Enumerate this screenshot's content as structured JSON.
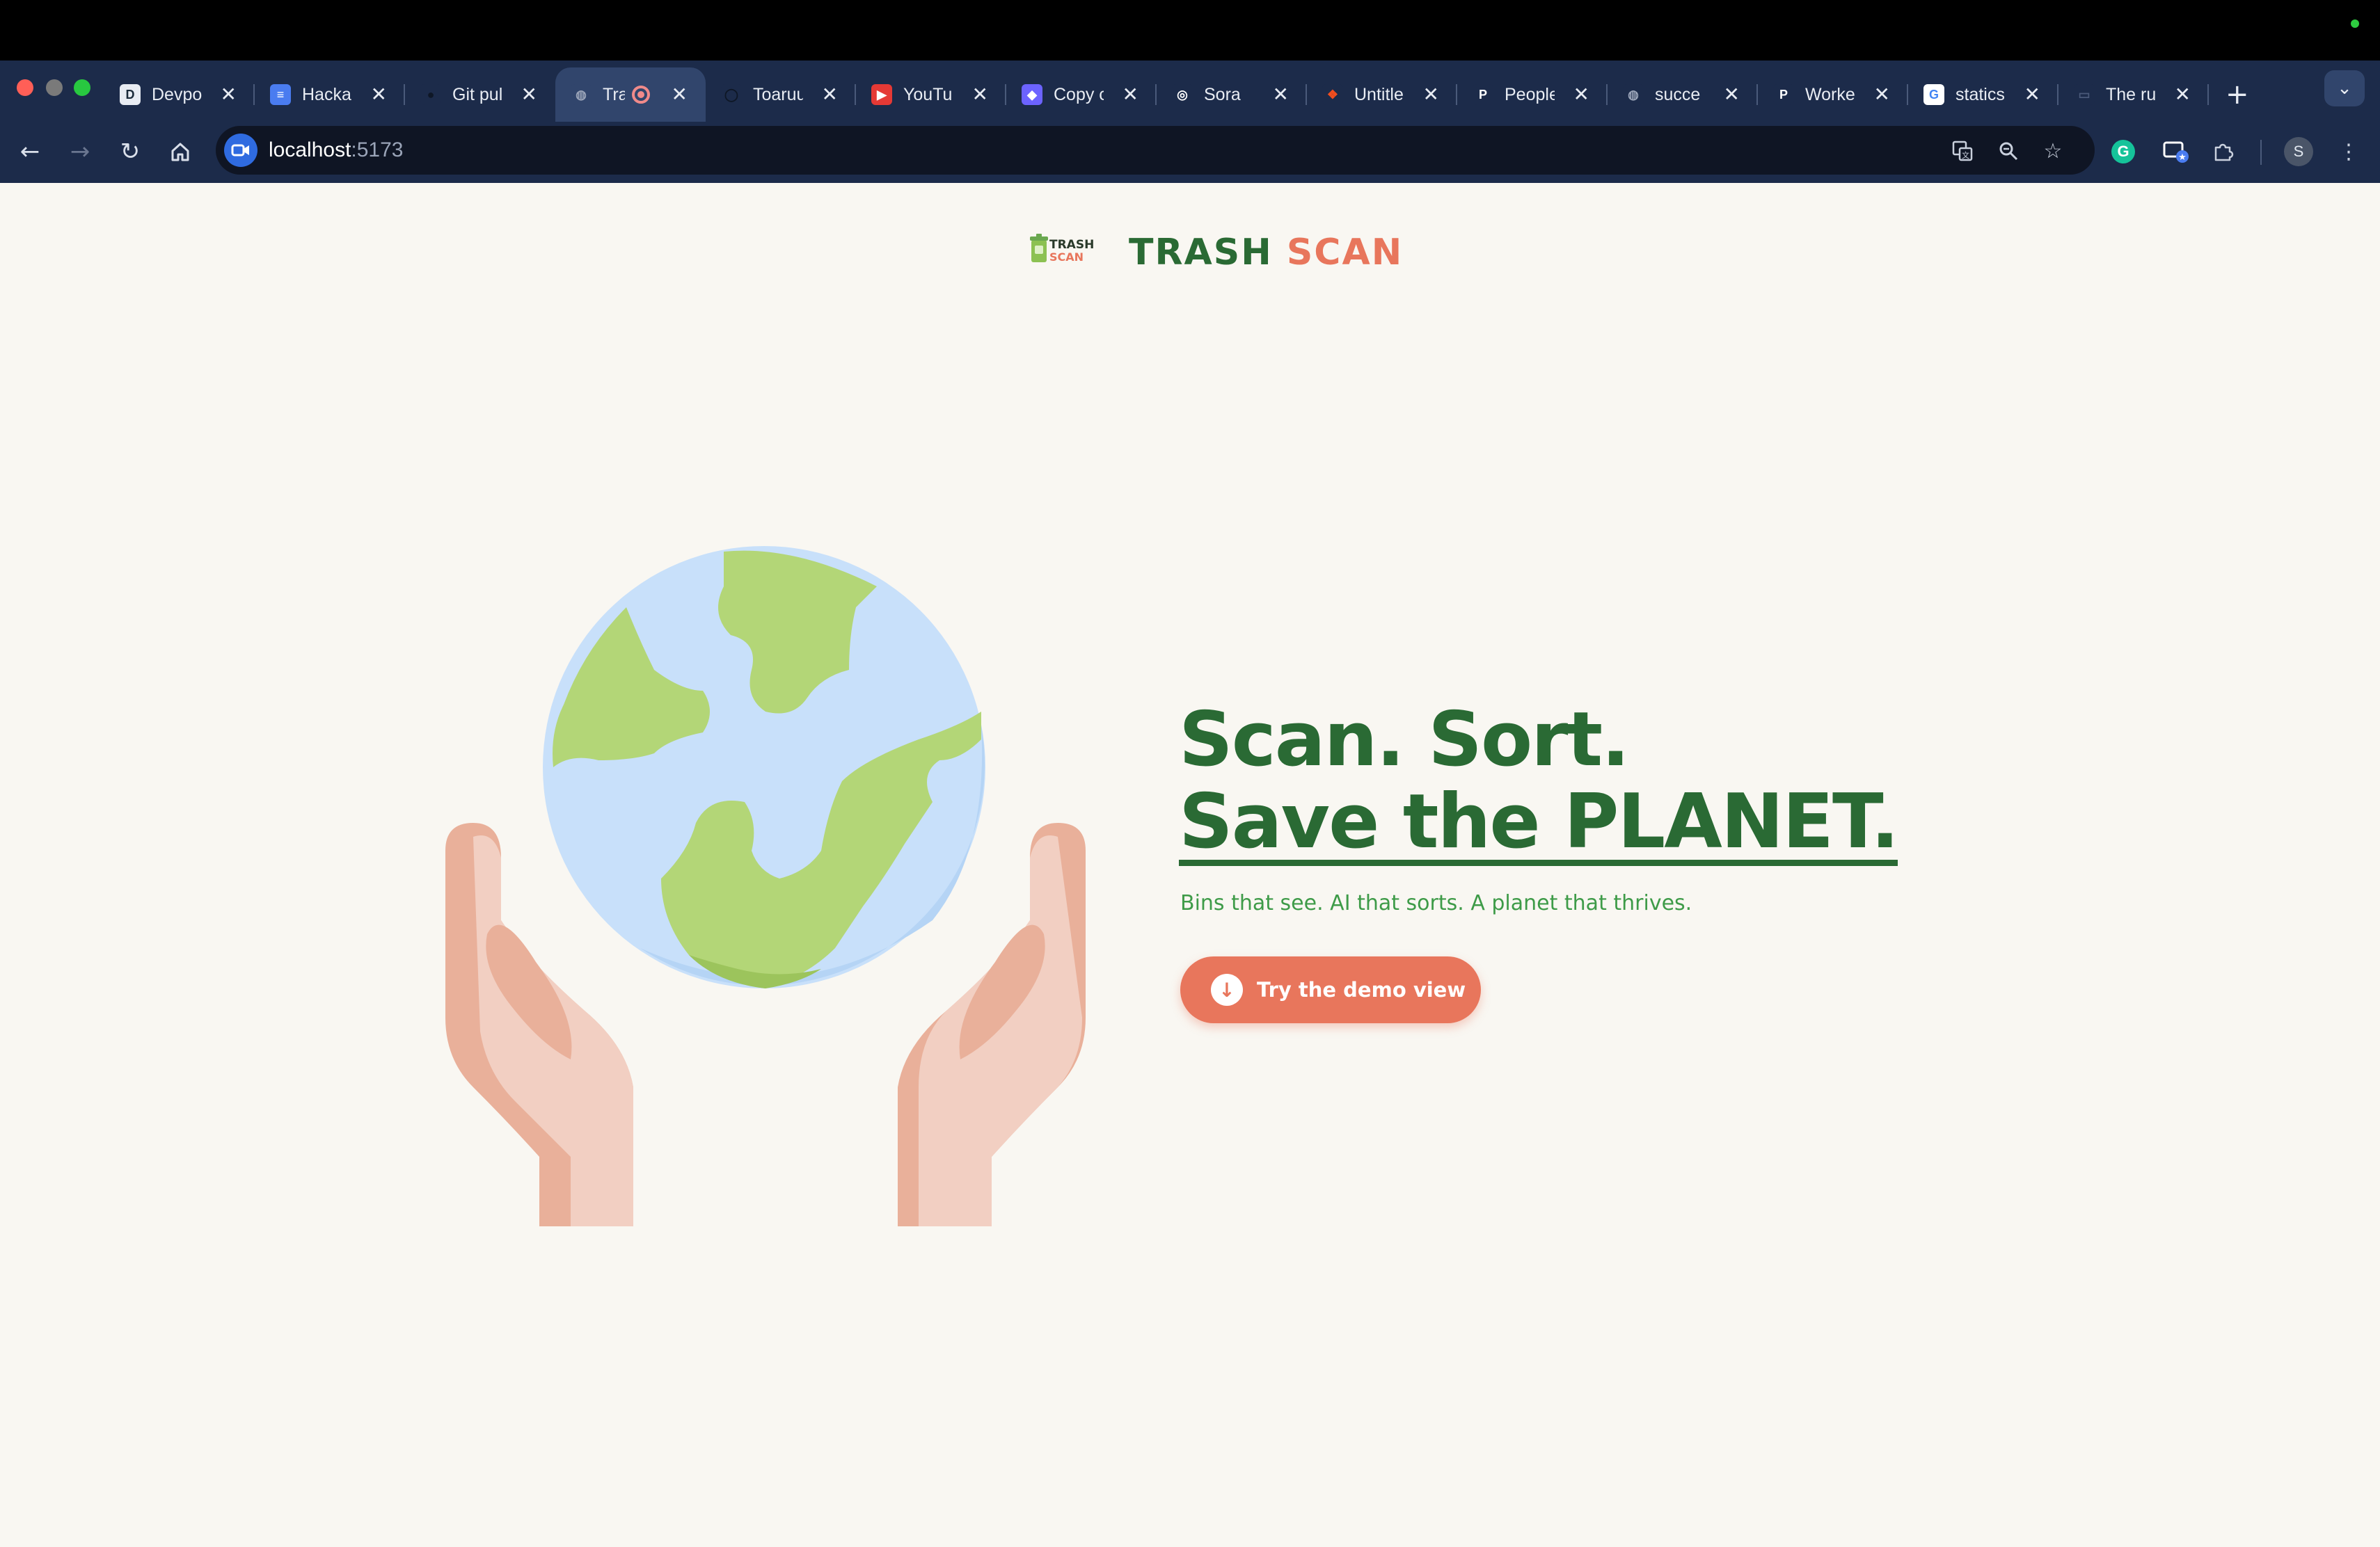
{
  "browser": {
    "tabs": [
      {
        "label": "Devpo",
        "favicon": "D",
        "favicon_color": "#1a2a3a",
        "favicon_bg": "#e8ecf3"
      },
      {
        "label": "Hacka",
        "favicon": "≡",
        "favicon_color": "#ffffff",
        "favicon_bg": "#4a7cf0"
      },
      {
        "label": "Git pul",
        "favicon": "●",
        "favicon_color": "#0e1726",
        "favicon_bg": "#1c2b4a"
      },
      {
        "label": "Tra",
        "favicon": "◍",
        "favicon_color": "#9aa4b8",
        "favicon_bg": "#31456c",
        "active": true,
        "recording": true
      },
      {
        "label": "Toaruu",
        "favicon": "◯",
        "favicon_color": "#0e1726",
        "favicon_bg": "#1c2b4a"
      },
      {
        "label": "YouTub",
        "favicon": "▶",
        "favicon_color": "#ffffff",
        "favicon_bg": "#e53935"
      },
      {
        "label": "Copy c",
        "favicon": "◆",
        "favicon_color": "#ffffff",
        "favicon_bg": "#6c63ff"
      },
      {
        "label": "Sora",
        "favicon": "◎",
        "favicon_color": "#ffffff",
        "favicon_bg": "#1c2b4a"
      },
      {
        "label": "Untitle",
        "favicon": "❖",
        "favicon_color": "#f24e1e",
        "favicon_bg": "#1c2b4a"
      },
      {
        "label": "People",
        "favicon": "P",
        "favicon_color": "#ffffff",
        "favicon_bg": "#1c2b4a"
      },
      {
        "label": "succe",
        "favicon": "◍",
        "favicon_color": "#9aa4b8",
        "favicon_bg": "#1c2b4a"
      },
      {
        "label": "Worke",
        "favicon": "P",
        "favicon_color": "#ffffff",
        "favicon_bg": "#1c2b4a"
      },
      {
        "label": "statics",
        "favicon": "G",
        "favicon_color": "#4285f4",
        "favicon_bg": "#ffffff"
      },
      {
        "label": "The ru",
        "favicon": "▭",
        "favicon_color": "#4a5a7a",
        "favicon_bg": "#1c2b4a"
      }
    ],
    "new_tab": "+",
    "tab_menu": "⌄",
    "url_host": "localhost",
    "url_port": ":5173",
    "profile_initial": "S"
  },
  "page": {
    "brand_word1": "TRASH",
    "brand_word2": "SCAN",
    "logo_text1": "TRASH",
    "logo_text2": "SCAN",
    "headline_line1": "Scan. Sort.",
    "headline_line2": "Save the PLANET.",
    "tagline": "Bins that see. AI that sorts. A planet that thrives.",
    "cta_label": "Try the demo view"
  },
  "colors": {
    "brand_green": "#2a6a34",
    "brand_coral": "#e8765c",
    "tagline_green": "#3e9b48",
    "page_bg": "#f9f7f2",
    "browser_chrome": "#1c2b4a"
  }
}
